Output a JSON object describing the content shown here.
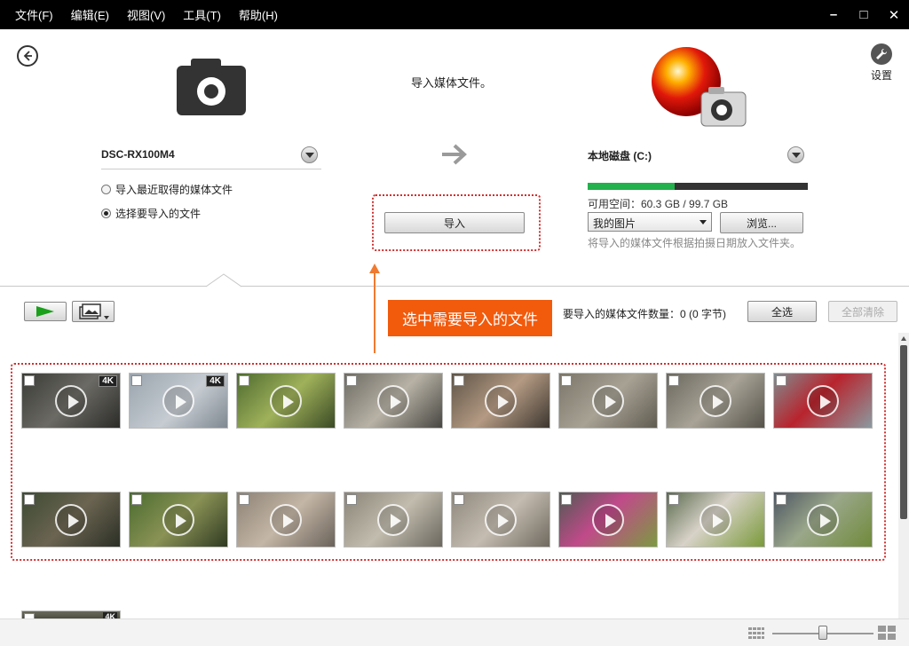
{
  "menu": {
    "items": [
      "文件(F)",
      "编辑(E)",
      "视图(V)",
      "工具(T)",
      "帮助(H)"
    ]
  },
  "window_controls": {
    "minimize": "–",
    "maximize": "□",
    "close": "✕"
  },
  "header": {
    "settings_label": "设置"
  },
  "source": {
    "device_name": "DSC-RX100M4",
    "options": [
      "导入最近取得的媒体文件",
      "选择要导入的文件"
    ],
    "selected_option": 1
  },
  "center": {
    "caption": "导入媒体文件。",
    "import_button": "导入"
  },
  "destination": {
    "disk_name": "本地磁盘 (C:)",
    "used_fraction": 0.395,
    "free_space": "可用空间：60.3 GB / 99.7 GB",
    "folder": "我的图片",
    "browse_button": "浏览...",
    "hint": "将导入的媒体文件根据拍摄日期放入文件夹。"
  },
  "toolbar": {
    "callout": "选中需要导入的文件",
    "count_label": "要导入的媒体文件数量：0 (0 字节)",
    "select_all": "全选",
    "clear_all": "全部清除"
  },
  "badge_4k": "4K",
  "thumbnails": [
    {
      "badge": "4K",
      "bg": "linear-gradient(135deg,#3a3a36,#6b6a64 50%,#2b2b28)"
    },
    {
      "badge": "4K",
      "bg": "linear-gradient(135deg,#9aa4ad,#c6ccd2 55%,#7f8890)"
    },
    {
      "badge": "",
      "bg": "linear-gradient(135deg,#4d6a2f,#9fb15a 50%,#3b4a25)"
    },
    {
      "badge": "",
      "bg": "linear-gradient(135deg,#6c6a62,#b8b2a6 50%,#474641)"
    },
    {
      "badge": "",
      "bg": "linear-gradient(135deg,#5d5346,#b49a83 50%,#3c362f)"
    },
    {
      "badge": "",
      "bg": "linear-gradient(135deg,#7a7568,#a7a294 50%,#615c51)"
    },
    {
      "badge": "",
      "bg": "linear-gradient(135deg,#6a675e,#a8a396 50%,#55524a)"
    },
    {
      "badge": "",
      "bg": "linear-gradient(135deg,#7e8d90,#b8242d 45%,#8a9aa0)"
    },
    {
      "badge": "",
      "bg": "linear-gradient(135deg,#3c4a33,#6b6451 50%,#2b2f25)"
    },
    {
      "badge": "",
      "bg": "linear-gradient(135deg,#4a6b2f,#8a9255 50%,#2f3a22)"
    },
    {
      "badge": "",
      "bg": "linear-gradient(135deg,#8c8275,#c4b6a6 50%,#6a625a)"
    },
    {
      "badge": "",
      "bg": "linear-gradient(135deg,#8a8478,#c2bcae 50%,#6c675e)"
    },
    {
      "badge": "",
      "bg": "linear-gradient(135deg,#8e877c,#c4bcb0 50%,#6f695f)"
    },
    {
      "badge": "",
      "bg": "linear-gradient(135deg,#4f5a52,#c04a8a 45%,#7c9a40)"
    },
    {
      "badge": "",
      "bg": "linear-gradient(135deg,#5a6b4e,#d8d2c8 45%,#7a9a3a)"
    },
    {
      "badge": "",
      "bg": "linear-gradient(135deg,#4c5462,#9aa78a 45%,#6f8a3a)"
    }
  ]
}
